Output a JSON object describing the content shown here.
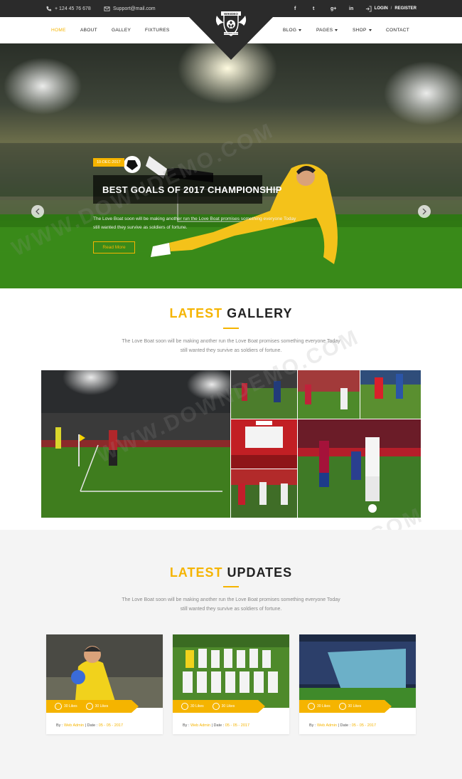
{
  "topbar": {
    "phone": "+ 124 45 76 678",
    "email": "Support@mail.com",
    "social": [
      "f",
      "t",
      "g+",
      "in"
    ],
    "login": "LOGIN",
    "separator": "/",
    "register": "REGISTER"
  },
  "nav": {
    "left": [
      "HOME",
      "ABOUT",
      "GALLEY",
      "FIXTURES"
    ],
    "right": [
      "BLOG",
      "PAGES",
      "SHOP",
      "CONTACT"
    ],
    "active": "HOME",
    "logo_text": "WIKIDEO",
    "logo_sub": "FOOTBALL CLUB"
  },
  "hero": {
    "date": "10-DEC-2017",
    "title": "BEST GOALS OF 2017 CHAMPIONSHIP",
    "description": "The Love Boat soon will be making another run the Love Boat promises something everyone Today still wanted they survive as soldiers of fortune.",
    "button": "Read More"
  },
  "gallery": {
    "title_accent": "LATEST",
    "title_rest": " GALLERY",
    "description": "The Love Boat soon will be making another run the Love Boat promises something everyone Today still wanted they survive as soldiers of fortune."
  },
  "updates": {
    "title_accent": "LATEST",
    "title_rest": " UPDATES",
    "description": "The Love Boat soon will be making another run the Love Boat promises something everyone Today still wanted they survive as soldiers of fortune.",
    "cards": [
      {
        "likes": "30 Likes",
        "comments": "30 Likes",
        "by": "By :",
        "author": "Web Admin",
        "date_label": "Date :",
        "date": "05 - 05 - 2017"
      },
      {
        "likes": "30 Likes",
        "comments": "30 Likes",
        "by": "By :",
        "author": "Web Admin",
        "date_label": "Date :",
        "date": "05 - 05 - 2017"
      },
      {
        "likes": "30 Likes",
        "comments": "30 Likes",
        "by": "By :",
        "author": "Web Admin",
        "date_label": "Date :",
        "date": "05 - 05 - 2017"
      }
    ]
  },
  "watermark": "WWW.DOWNDEMO.COM",
  "colors": {
    "accent": "#f5b400",
    "dark": "#2b2b2b"
  }
}
